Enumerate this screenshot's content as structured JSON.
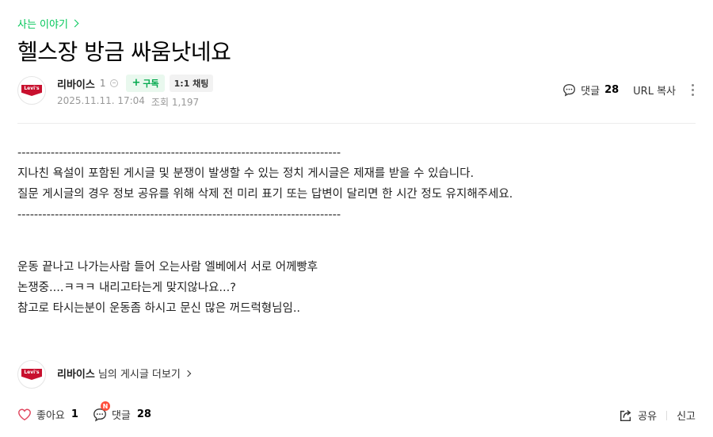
{
  "breadcrumb": {
    "label": "사는 이야기"
  },
  "post": {
    "title": "헬스장 방금 싸움낫네요",
    "author": {
      "name": "리바이스",
      "level": "1",
      "subscribe_label": "구독",
      "chat_label": "1:1 채팅",
      "avatar_text": "Levi's"
    },
    "date": "2025.11.11. 17:04",
    "views": "조회 1,197"
  },
  "toolbar": {
    "comment_label": "댓글",
    "comment_count": "28",
    "url_copy_label": "URL 복사"
  },
  "body": {
    "notice_divider_top": "------------------------------------------------------------------------------",
    "notice_line_1": "지나친 욕설이 포함된 게시글 및 분쟁이 발생할 수 있는 정치 게시글은 제재를 받을 수 있습니다.",
    "notice_line_2": "질문 게시글의 경우 정보 공유를 위해 삭제 전 미리 표기 또는 답변이 달리면 한 시간 정도 유지해주세요.",
    "notice_divider_bottom": "------------------------------------------------------------------------------",
    "content_line_1": "운동 끝나고 나가는사람 들어 오는사람 엘베에서 서로 어께빵후",
    "content_line_2": "논쟁중....ㅋㅋㅋ 내리고타는게 맞지않나요...?",
    "content_line_3": "참고로 타시는분이 운동좀 하시고 문신 많은 꺼드럭형님임.."
  },
  "more_posts": {
    "author": "리바이스",
    "suffix": "님의 게시글 더보기"
  },
  "footer": {
    "like_label": "좋아요",
    "like_count": "1",
    "comment_label": "댓글",
    "comment_count": "28",
    "new_badge": "N",
    "share_label": "공유",
    "report_label": "신고"
  },
  "colors": {
    "accent_green": "#03c75a",
    "levis_red": "#c8102e",
    "badge_red": "#ff4e3b"
  }
}
